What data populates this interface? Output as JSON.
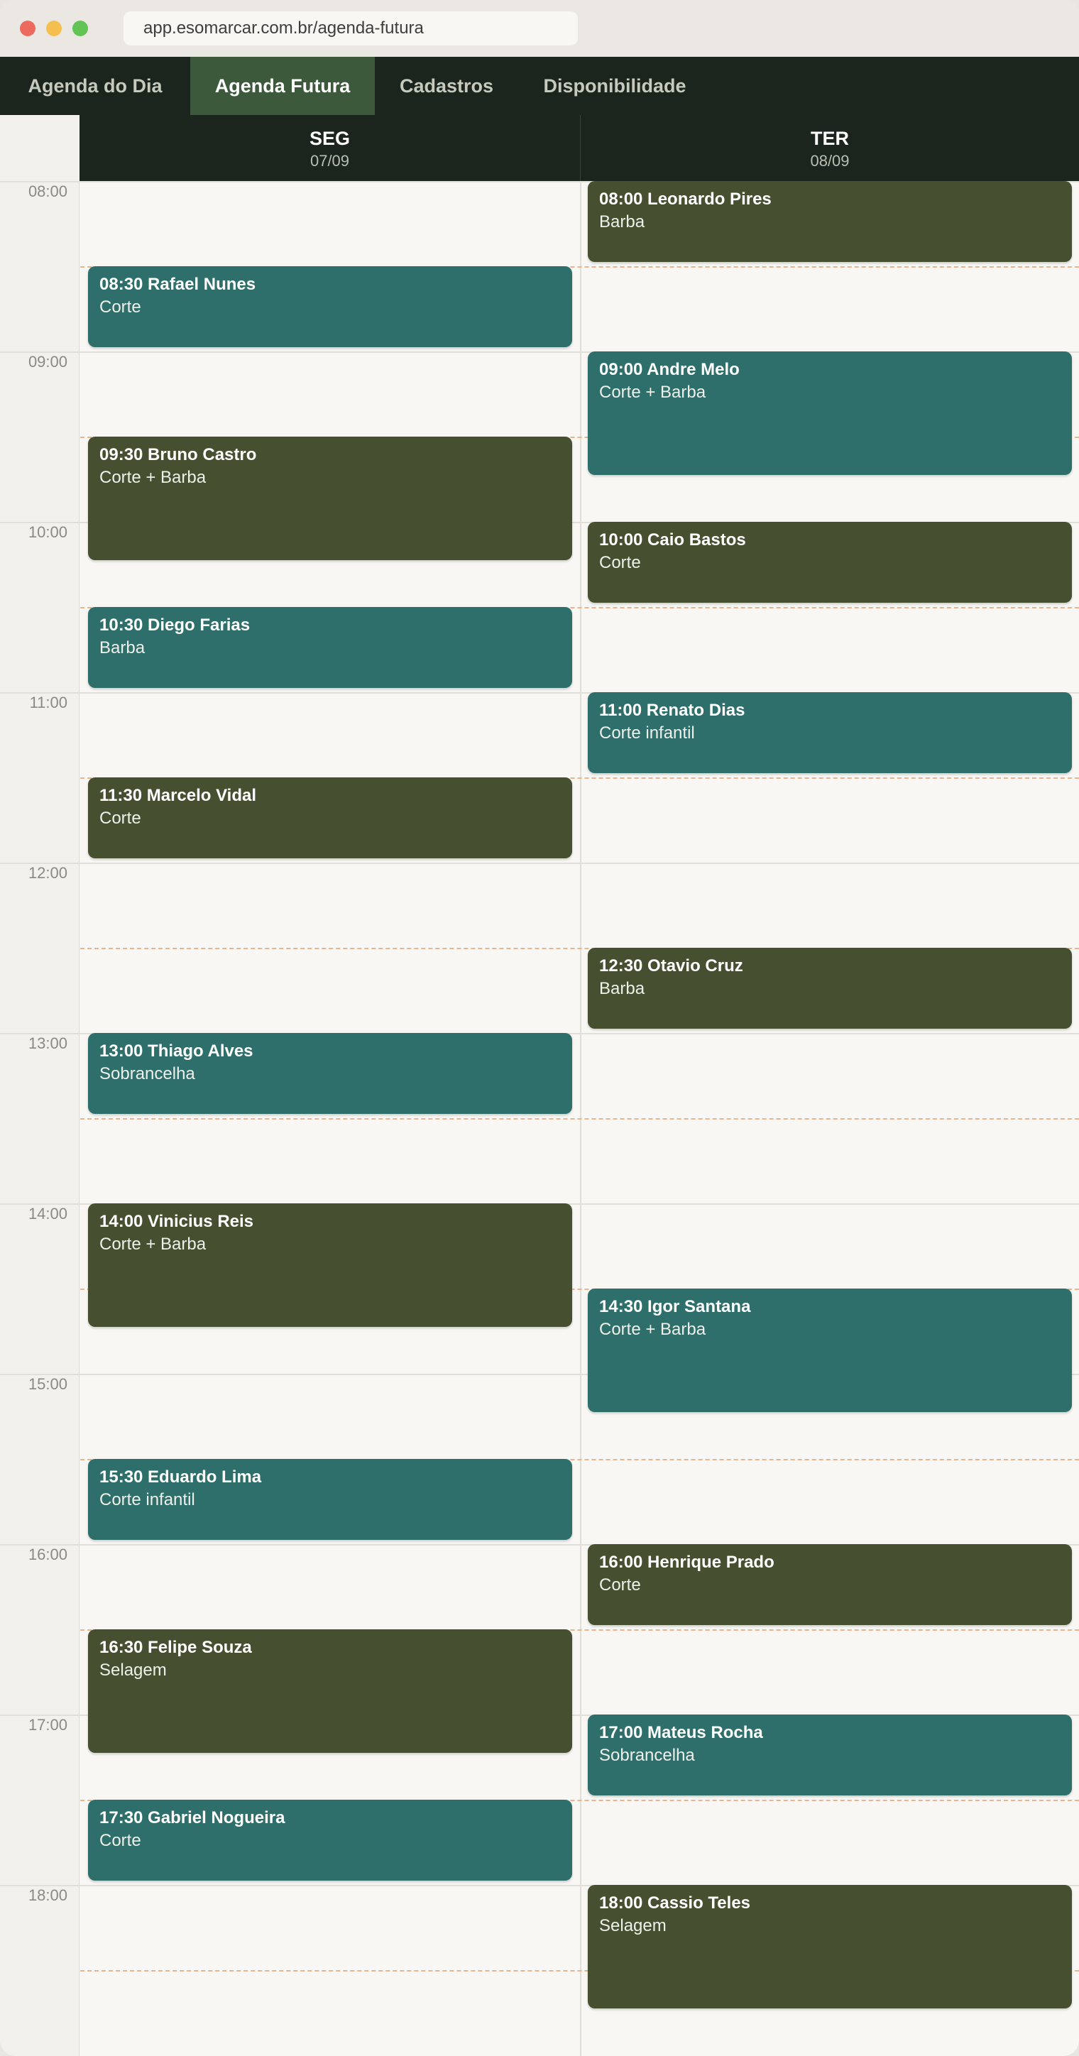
{
  "browser": {
    "url": "app.esomarcar.com.br/agenda-futura"
  },
  "nav": {
    "items": [
      {
        "label": "Agenda do Dia",
        "active": false
      },
      {
        "label": "Agenda Futura",
        "active": true
      },
      {
        "label": "Cadastros",
        "active": false
      },
      {
        "label": "Disponibilidade",
        "active": false
      }
    ]
  },
  "colors": {
    "teal": "#2f6f6b",
    "olive": "#465030",
    "nav_bg": "#1c241e",
    "nav_active": "#3c5a3b"
  },
  "calendar": {
    "hours": [
      "08:00",
      "09:00",
      "10:00",
      "11:00",
      "12:00",
      "13:00",
      "14:00",
      "15:00",
      "16:00",
      "17:00",
      "18:00"
    ],
    "days": [
      {
        "name": "SEG",
        "date": "07/09",
        "events": [
          {
            "start": "08:30",
            "duration_min": 30,
            "title": "08:30 Rafael Nunes",
            "service": "Corte",
            "color": "teal"
          },
          {
            "start": "09:30",
            "duration_min": 45,
            "title": "09:30 Bruno Castro",
            "service": "Corte + Barba",
            "color": "olive"
          },
          {
            "start": "10:30",
            "duration_min": 30,
            "title": "10:30 Diego Farias",
            "service": "Barba",
            "color": "teal"
          },
          {
            "start": "11:30",
            "duration_min": 30,
            "title": "11:30 Marcelo Vidal",
            "service": "Corte",
            "color": "olive"
          },
          {
            "start": "13:00",
            "duration_min": 30,
            "title": "13:00 Thiago Alves",
            "service": "Sobrancelha",
            "color": "teal"
          },
          {
            "start": "14:00",
            "duration_min": 45,
            "title": "14:00 Vinicius Reis",
            "service": "Corte + Barba",
            "color": "olive"
          },
          {
            "start": "15:30",
            "duration_min": 30,
            "title": "15:30 Eduardo Lima",
            "service": "Corte infantil",
            "color": "teal"
          },
          {
            "start": "16:30",
            "duration_min": 45,
            "title": "16:30 Felipe Souza",
            "service": "Selagem",
            "color": "olive"
          },
          {
            "start": "17:30",
            "duration_min": 30,
            "title": "17:30 Gabriel Nogueira",
            "service": "Corte",
            "color": "teal"
          }
        ]
      },
      {
        "name": "TER",
        "date": "08/09",
        "events": [
          {
            "start": "08:00",
            "duration_min": 30,
            "title": "08:00 Leonardo Pires",
            "service": "Barba",
            "color": "olive"
          },
          {
            "start": "09:00",
            "duration_min": 45,
            "title": "09:00 Andre Melo",
            "service": "Corte + Barba",
            "color": "teal"
          },
          {
            "start": "10:00",
            "duration_min": 30,
            "title": "10:00 Caio Bastos",
            "service": "Corte",
            "color": "olive"
          },
          {
            "start": "11:00",
            "duration_min": 30,
            "title": "11:00 Renato Dias",
            "service": "Corte infantil",
            "color": "teal"
          },
          {
            "start": "12:30",
            "duration_min": 30,
            "title": "12:30 Otavio Cruz",
            "service": "Barba",
            "color": "olive"
          },
          {
            "start": "14:30",
            "duration_min": 45,
            "title": "14:30 Igor Santana",
            "service": "Corte + Barba",
            "color": "teal"
          },
          {
            "start": "16:00",
            "duration_min": 30,
            "title": "16:00 Henrique Prado",
            "service": "Corte",
            "color": "olive"
          },
          {
            "start": "17:00",
            "duration_min": 30,
            "title": "17:00 Mateus Rocha",
            "service": "Sobrancelha",
            "color": "teal"
          },
          {
            "start": "18:00",
            "duration_min": 45,
            "title": "18:00 Cassio Teles",
            "service": "Selagem",
            "color": "olive"
          }
        ]
      }
    ]
  }
}
